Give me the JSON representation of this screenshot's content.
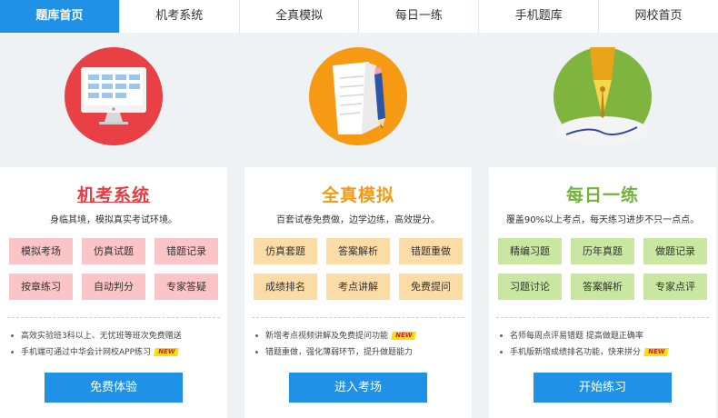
{
  "nav": {
    "tabs": [
      {
        "label": "题库首页",
        "active": true
      },
      {
        "label": "机考系统"
      },
      {
        "label": "全真模拟"
      },
      {
        "label": "每日一练"
      },
      {
        "label": "手机题库"
      },
      {
        "label": "网校首页"
      }
    ]
  },
  "colors": {
    "accent": "#1f92e8",
    "red": "#e83a3f",
    "orange": "#f39b19",
    "green": "#73b23d",
    "new_badge": "#ffdf00"
  },
  "cards": [
    {
      "title": "机考系统",
      "subtitle": "身临其境，模拟真实考试环境。",
      "icon": "monitor-icon",
      "buttons": [
        "模拟考场",
        "仿真试题",
        "错题记录",
        "按章练习",
        "自动判分",
        "专家答疑"
      ],
      "notes": [
        {
          "text": "高效实验班3科以上、无忧班等班次免费赠送",
          "new": ""
        },
        {
          "text": "手机端可通过中华会计网校APP练习",
          "new": "NEW"
        }
      ],
      "cta": "免费体验"
    },
    {
      "title": "全真模拟",
      "subtitle": "百套试卷免费做，边学边练，高效提分。",
      "icon": "paper-pencil-icon",
      "buttons": [
        "仿真套题",
        "答案解析",
        "错题重做",
        "成绩排名",
        "考点讲解",
        "免费提问"
      ],
      "notes": [
        {
          "text": "新增考点视频讲解及免费提问功能",
          "new": "NEW"
        },
        {
          "text": "错题重做，强化薄弱环节，提升做题能力",
          "new": ""
        }
      ],
      "cta": "进入考场"
    },
    {
      "title": "每日一练",
      "subtitle": "覆盖90%以上考点，每天练习进步不只一点点。",
      "icon": "fountain-pen-icon",
      "buttons": [
        "精编习题",
        "历年真题",
        "做题记录",
        "习题讨论",
        "答案解析",
        "专家点评"
      ],
      "notes": [
        {
          "text": "名师每周点评易错题  提高做题正确率",
          "new": ""
        },
        {
          "text": "手机版新增成绩排名功能，快来拼分",
          "new": "NEW"
        }
      ],
      "cta": "开始练习"
    }
  ]
}
